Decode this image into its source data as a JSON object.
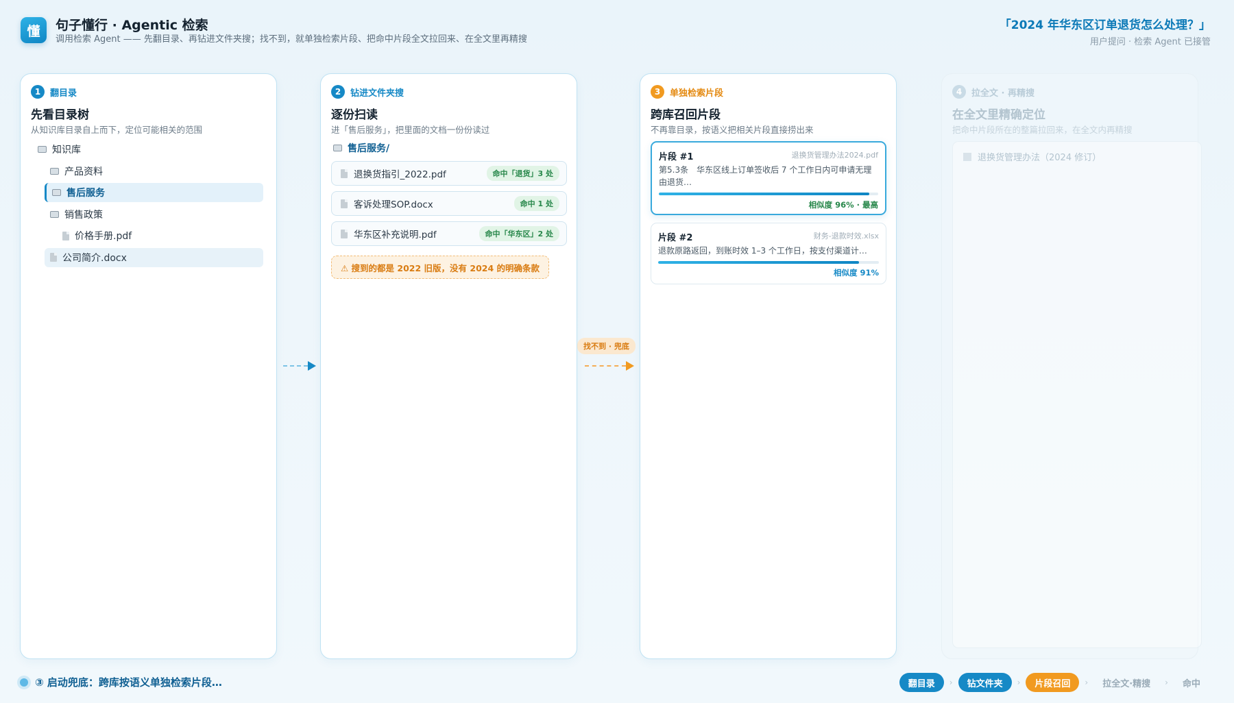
{
  "header": {
    "logo_char": "懂",
    "title": "句子懂行 · Agentic 检索",
    "subtitle": "调用检索 Agent —— 先翻目录、再钻进文件夹搜；找不到，就单独检索片段、把命中片段全文拉回来、在全文里再精搜",
    "query": "「2024 年华东区订单退货怎么处理？」",
    "query_status": "用户提问 · 检索 Agent 已接管"
  },
  "panels": [
    {
      "num": "1",
      "tag": "翻目录",
      "title": "先看目录树",
      "subtitle": "从知识库目录自上而下，定位可能相关的范围",
      "tree": [
        {
          "label": "知识库",
          "type": "folder",
          "depth": 0,
          "state": ""
        },
        {
          "label": "产品资料",
          "type": "folder",
          "depth": 1,
          "state": ""
        },
        {
          "label": "售后服务",
          "type": "folder",
          "depth": 1,
          "state": "selected"
        },
        {
          "label": "销售政策",
          "type": "folder",
          "depth": 1,
          "state": ""
        },
        {
          "label": "价格手册.pdf",
          "type": "file",
          "depth": 2,
          "state": ""
        },
        {
          "label": "公司简介.docx",
          "type": "file",
          "depth": 1,
          "state": "highlight"
        }
      ]
    },
    {
      "num": "2",
      "tag": "钻进文件夹搜",
      "title": "逐份扫读",
      "subtitle": "进「售后服务」，把里面的文档一份份读过",
      "folder": "售后服务/",
      "files": [
        {
          "name": "退换货指引_2022.pdf",
          "hit": "命中「退货」3 处"
        },
        {
          "name": "客诉处理SOP.docx",
          "hit": "命中 1 处"
        },
        {
          "name": "华东区补充说明.pdf",
          "hit": "命中「华东区」2 处"
        }
      ],
      "warning": "⚠ 搜到的都是 2022 旧版，没有 2024 的明确条款"
    },
    {
      "num": "3",
      "tag": "单独检索片段",
      "title": "跨库召回片段",
      "subtitle": "不再靠目录，按语义把相关片段直接捞出来",
      "chunks": [
        {
          "id": "片段 #1",
          "source": "退换货管理办法2024.pdf",
          "text": "第5.3条　华东区线上订单签收后 7 个工作日内可申请无理由退货…",
          "similarity": 0.96,
          "score_label": "相似度 96% · 最高"
        },
        {
          "id": "片段 #2",
          "source": "财务-退款时效.xlsx",
          "text": "退款原路返回，到账时效 1–3 个工作日，按支付渠道计…",
          "similarity": 0.91,
          "score_label": "相似度 91%"
        }
      ]
    },
    {
      "num": "4",
      "tag": "拉全文 · 再精搜",
      "title": "在全文里精确定位",
      "subtitle": "把命中片段所在的整篇拉回来，在全文内再精搜",
      "doc_title": "退换货管理办法（2024 修订）"
    }
  ],
  "fallback_label": "找不到 · 兜底",
  "status_text": "③ 启动兜底：跨库按语义单独检索片段…",
  "pipeline": [
    {
      "label": "翻目录",
      "state": "done"
    },
    {
      "label": "钻文件夹",
      "state": "done"
    },
    {
      "label": "片段召回",
      "state": "active"
    },
    {
      "label": "拉全文·精搜",
      "state": "pending"
    },
    {
      "label": "命中",
      "state": "pending"
    }
  ],
  "colors": {
    "primary": "#1689c6",
    "accent": "#f19a20",
    "success": "#27874a"
  }
}
